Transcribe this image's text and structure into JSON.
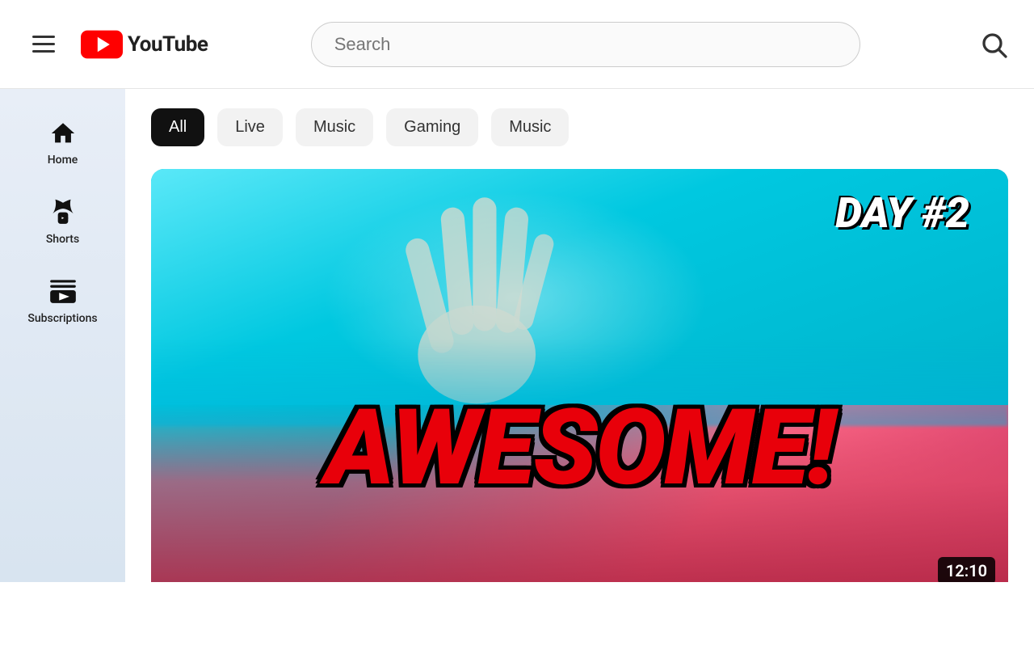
{
  "header": {
    "menu_label": "Menu",
    "logo_text": "YouTube",
    "search_placeholder": "Search"
  },
  "sidebar": {
    "items": [
      {
        "id": "home",
        "label": "Home",
        "icon": "home"
      },
      {
        "id": "shorts",
        "label": "Shorts",
        "icon": "shorts"
      },
      {
        "id": "subscriptions",
        "label": "Subscriptions",
        "icon": "subscriptions"
      }
    ]
  },
  "filters": {
    "chips": [
      {
        "id": "all",
        "label": "All",
        "active": true
      },
      {
        "id": "live",
        "label": "Live",
        "active": false
      },
      {
        "id": "music",
        "label": "Music",
        "active": false
      },
      {
        "id": "gaming",
        "label": "Gaming",
        "active": false
      },
      {
        "id": "music2",
        "label": "Music",
        "active": false
      }
    ]
  },
  "video": {
    "title": "AWESOME! DAY #2",
    "day_label": "DAY #2",
    "awesome_label": "AWESOME!",
    "duration": "12:10"
  }
}
